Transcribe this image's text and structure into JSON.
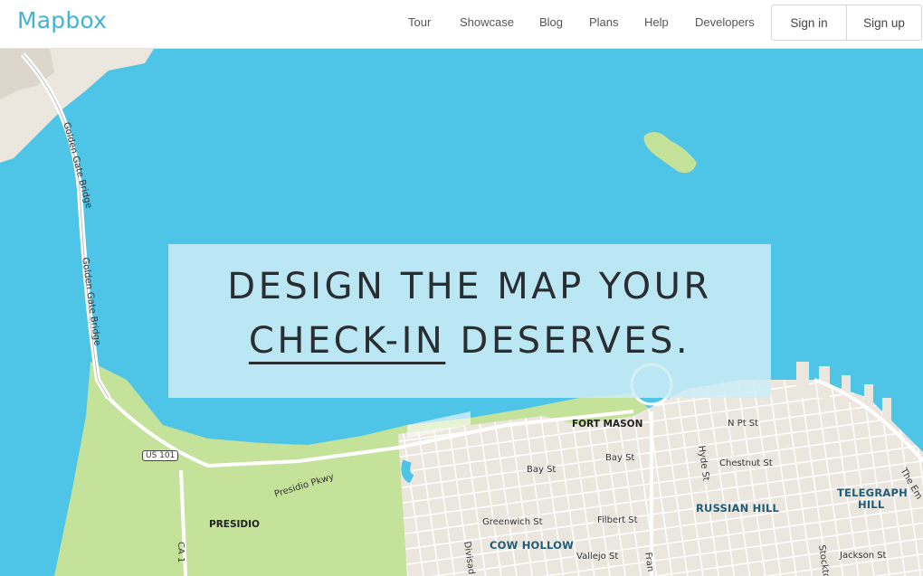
{
  "header": {
    "logo": "Mapbox",
    "nav": [
      {
        "label": "Tour"
      },
      {
        "label": "Showcase"
      },
      {
        "label": "Blog"
      },
      {
        "label": "Plans"
      },
      {
        "label": "Help"
      },
      {
        "label": "Developers"
      }
    ],
    "signin_label": "Sign in",
    "signup_label": "Sign up"
  },
  "hero": {
    "line1": "DESIGN THE MAP YOUR",
    "line2_highlight": "CHECK-IN",
    "line2_rest": "DESERVES."
  },
  "map": {
    "labels": {
      "golden_gate_bridge_1": "Golden Gate Bridge",
      "golden_gate_bridge_2": "Golden Gate Bridge",
      "fort_mason": "FORT MASON",
      "n_pt_st": "N Pt St",
      "bay_st_1": "Bay St",
      "bay_st_2": "Bay St",
      "chestnut_st": "Chestnut St",
      "hyde_st": "Hyde St",
      "russian_hill": "RUSSIAN HILL",
      "telegraph_hill_1": "TELEGRAPH",
      "telegraph_hill_2": "HILL",
      "the_embarcadero": "The Em",
      "us_101": "US 101",
      "presidio_pkwy": "Presidio Pkwy",
      "presidio": "PRESIDIO",
      "ca_1": "CA 1",
      "greenwich_st": "Greenwich St",
      "filbert_st": "Filbert St",
      "cow_hollow": "COW HOLLOW",
      "vallejo_st": "Vallejo St",
      "jackson_st": "Jackson St",
      "divisadero": "Divisad",
      "stockton": "Stockto",
      "franklin": "Fran"
    },
    "colors": {
      "water": "#4ec4e6",
      "park": "#c5e29a",
      "land": "#ebe7df",
      "road": "#ffffff"
    }
  }
}
